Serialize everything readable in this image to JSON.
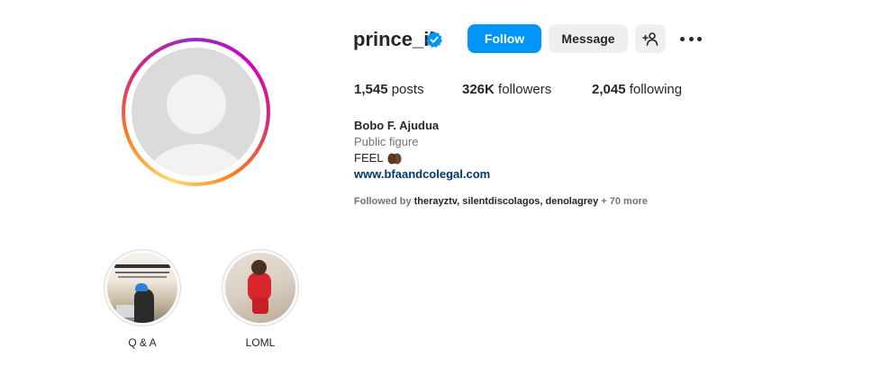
{
  "profile": {
    "username": "prince_ii",
    "verified_icon": "verified-badge-icon",
    "follow_label": "Follow",
    "message_label": "Message",
    "add_icon": "add-person-icon",
    "more_icon": "more-options-icon",
    "full_name": "Bobo F. Ajudua",
    "category": "Public figure",
    "bio": "FEEL",
    "website": "www.bfaandcolegal.com",
    "followed_by_prefix": "Followed by",
    "followed_by_names": "therayztv, silentdiscolagos, denolagrey",
    "followed_by_more": "+ 70 more"
  },
  "stats": {
    "posts_count": "1,545",
    "posts_label": "posts",
    "followers_count": "326K",
    "followers_label": "followers",
    "following_count": "2,045",
    "following_label": "following"
  },
  "highlights": [
    {
      "label": "Q & A"
    },
    {
      "label": "LOML"
    }
  ],
  "colors": {
    "primary_button": "#0095f6",
    "secondary_button": "#efefef",
    "link": "#00376b",
    "muted": "#737373",
    "verified": "#0095f6"
  }
}
